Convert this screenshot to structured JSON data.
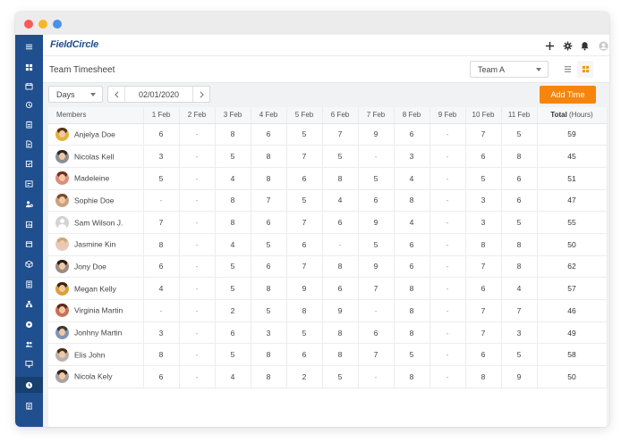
{
  "app": {
    "logo_text": "FieldCircle",
    "page_title": "Team Timesheet"
  },
  "team_select": {
    "value": "Team A"
  },
  "controls": {
    "range_value": "Days",
    "date": "02/01/2020",
    "add_label": "Add Time"
  },
  "table": {
    "members_header": "Members",
    "total_header": "Total",
    "total_unit": "(Hours)",
    "days": [
      "1 Feb",
      "2 Feb",
      "3 Feb",
      "4 Feb",
      "5 Feb",
      "6 Feb",
      "7 Feb",
      "8 Feb",
      "9 Feb",
      "10 Feb",
      "11 Feb"
    ],
    "rows": [
      {
        "name": "Anjelya Doe",
        "avatar": {
          "bg": "#e3b23c",
          "hair": "#5a3418"
        },
        "hours": [
          "6",
          "-",
          "8",
          "6",
          "5",
          "7",
          "9",
          "6",
          "-",
          "7",
          "5"
        ],
        "total": "59"
      },
      {
        "name": "Nicolas Kell",
        "avatar": {
          "bg": "#8b8f96",
          "hair": "#2b2b2b"
        },
        "hours": [
          "3",
          "-",
          "5",
          "8",
          "7",
          "5",
          "-",
          "3",
          "-",
          "6",
          "8"
        ],
        "total": "45"
      },
      {
        "name": "Madeleine",
        "avatar": {
          "bg": "#d98f7a",
          "hair": "#6b2f1f"
        },
        "hours": [
          "5",
          "-",
          "4",
          "8",
          "6",
          "8",
          "5",
          "4",
          "-",
          "5",
          "6"
        ],
        "total": "51"
      },
      {
        "name": "Sophie Doe",
        "avatar": {
          "bg": "#c9a27f",
          "hair": "#7a4b2a"
        },
        "hours": [
          "-",
          "-",
          "8",
          "7",
          "5",
          "4",
          "6",
          "8",
          "-",
          "3",
          "6"
        ],
        "total": "47"
      },
      {
        "name": "Sam Wilson J.",
        "avatar": {
          "placeholder": true
        },
        "hours": [
          "7",
          "-",
          "8",
          "6",
          "7",
          "6",
          "9",
          "4",
          "-",
          "3",
          "5"
        ],
        "total": "55"
      },
      {
        "name": "Jasmine Kin",
        "avatar": {
          "bg": "#e7c9c0",
          "hair": "#c9a87a"
        },
        "hours": [
          "8",
          "-",
          "4",
          "5",
          "6",
          "-",
          "5",
          "6",
          "-",
          "8",
          "8"
        ],
        "total": "50"
      },
      {
        "name": "Jony Doe",
        "avatar": {
          "bg": "#9a8d85",
          "hair": "#2a1d15"
        },
        "hours": [
          "6",
          "-",
          "5",
          "6",
          "7",
          "8",
          "9",
          "6",
          "-",
          "7",
          "8"
        ],
        "total": "62"
      },
      {
        "name": "Megan Kelly",
        "avatar": {
          "bg": "#d8a13a",
          "hair": "#3b2413"
        },
        "hours": [
          "4",
          "-",
          "5",
          "8",
          "9",
          "6",
          "7",
          "8",
          "-",
          "6",
          "4"
        ],
        "total": "57"
      },
      {
        "name": "Virginia Martin",
        "avatar": {
          "bg": "#c96f5a",
          "hair": "#5b2a1a"
        },
        "hours": [
          "-",
          "-",
          "2",
          "5",
          "8",
          "9",
          "-",
          "8",
          "-",
          "7",
          "7"
        ],
        "total": "46"
      },
      {
        "name": "Jonhny Martin",
        "avatar": {
          "bg": "#7f95b3",
          "hair": "#3a3a3a"
        },
        "hours": [
          "3",
          "-",
          "6",
          "3",
          "5",
          "8",
          "6",
          "8",
          "-",
          "7",
          "3"
        ],
        "total": "49"
      },
      {
        "name": "Elis John",
        "avatar": {
          "bg": "#b9b1ab",
          "hair": "#4a2e1c"
        },
        "hours": [
          "8",
          "-",
          "5",
          "8",
          "6",
          "8",
          "7",
          "5",
          "-",
          "6",
          "5"
        ],
        "total": "58"
      },
      {
        "name": "Nicola Kely",
        "avatar": {
          "bg": "#a8a39e",
          "hair": "#2d241e"
        },
        "hours": [
          "6",
          "-",
          "4",
          "8",
          "2",
          "5",
          "-",
          "8",
          "-",
          "8",
          "9"
        ],
        "total": "50"
      }
    ]
  },
  "sidebar": {
    "items": [
      {
        "icon": "hamburger-menu-icon"
      },
      {
        "icon": "dashboard-icon"
      },
      {
        "icon": "calendar-icon"
      },
      {
        "icon": "dispatch-icon"
      },
      {
        "icon": "clipboard-icon"
      },
      {
        "icon": "document-icon"
      },
      {
        "icon": "checklist-icon"
      },
      {
        "icon": "schedule-icon"
      },
      {
        "icon": "user-settings-icon"
      },
      {
        "icon": "report-icon"
      },
      {
        "icon": "invoice-icon"
      },
      {
        "icon": "inventory-icon"
      },
      {
        "icon": "list-document-icon"
      },
      {
        "icon": "hierarchy-icon"
      },
      {
        "icon": "settings-circle-icon"
      },
      {
        "icon": "team-icon"
      },
      {
        "icon": "monitor-icon"
      },
      {
        "icon": "clock-icon",
        "active": true
      },
      {
        "icon": "timesheet-icon"
      }
    ]
  },
  "colors": {
    "sidebar": "#1f4f8e",
    "accent": "#f7850c",
    "logo": "#1f4f8e"
  }
}
